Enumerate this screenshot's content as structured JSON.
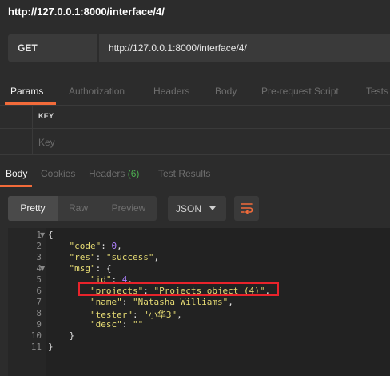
{
  "request": {
    "title": "http://127.0.0.1:8000/interface/4/",
    "method": "GET",
    "url": "http://127.0.0.1:8000/interface/4/"
  },
  "request_tabs": [
    "Params",
    "Authorization",
    "Headers",
    "Body",
    "Pre-request Script",
    "Tests"
  ],
  "params": {
    "key_header": "KEY",
    "key_placeholder": "Key"
  },
  "response_tabs": {
    "body": "Body",
    "cookies": "Cookies",
    "headers": "Headers",
    "headers_count": "(6)",
    "tests": "Test Results"
  },
  "view": {
    "pretty": "Pretty",
    "raw": "Raw",
    "preview": "Preview",
    "format": "JSON"
  },
  "icons": {
    "wrap": "wrap-lines-icon",
    "caret": "chevron-down-icon"
  },
  "colors": {
    "accent": "#f26b3a",
    "highlight": "#e8232b",
    "json_string": "#e6db74",
    "json_number": "#ae81ff"
  },
  "code": {
    "line_numbers": [
      "1",
      "2",
      "3",
      "4",
      "5",
      "6",
      "7",
      "8",
      "9",
      "10",
      "11"
    ],
    "lines": [
      "{",
      "    \"code\": 0,",
      "    \"res\": \"success\",",
      "    \"msg\": {",
      "        \"id\": 4,",
      "        \"projects\": \"Projects object (4)\",",
      "        \"name\": \"Natasha Williams\",",
      "        \"tester\": \"小华3\",",
      "        \"desc\": \"\"",
      "    }",
      "}"
    ]
  }
}
